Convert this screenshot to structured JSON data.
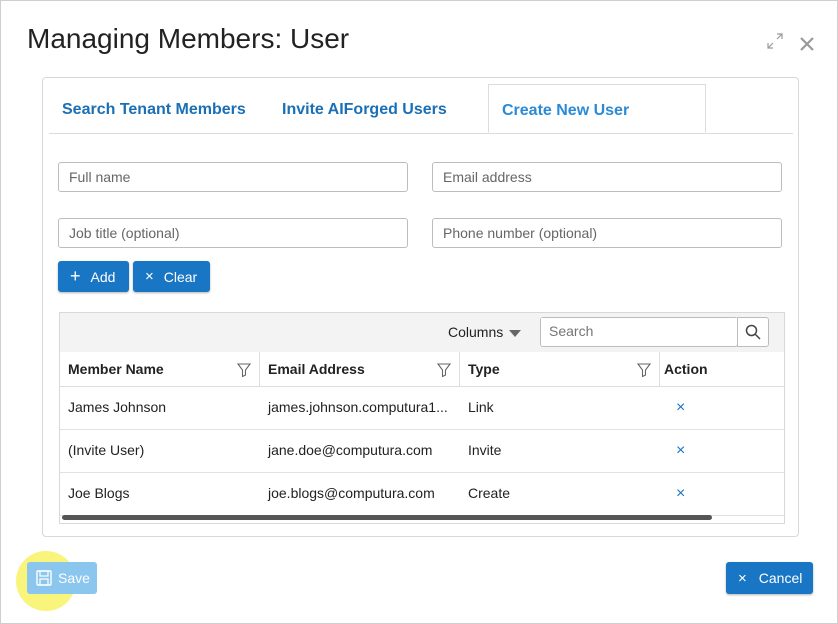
{
  "dialog": {
    "title": "Managing Members: User"
  },
  "tabs": [
    {
      "label": "Search Tenant Members"
    },
    {
      "label": "Invite AIForged Users"
    },
    {
      "label": "Create New User"
    }
  ],
  "form": {
    "full_name_placeholder": "Full name",
    "email_placeholder": "Email address",
    "job_title_placeholder": "Job title (optional)",
    "phone_placeholder": "Phone number (optional)",
    "add_label": "Add",
    "clear_label": "Clear"
  },
  "grid": {
    "columns_label": "Columns",
    "search_placeholder": "Search",
    "headers": [
      "Member Name",
      "Email Address",
      "Type",
      "Action"
    ],
    "rows": [
      {
        "name": "James Johnson",
        "email": "james.johnson.computura1...",
        "type": "Link"
      },
      {
        "name": "(Invite User)",
        "email": "jane.doe@computura.com",
        "type": "Invite"
      },
      {
        "name": "Joe Blogs",
        "email": "joe.blogs@computura.com",
        "type": "Create"
      }
    ]
  },
  "footer": {
    "save_label": "Save",
    "cancel_label": "Cancel"
  },
  "colors": {
    "primary": "#1976c4",
    "tab_text": "#1a6fb5",
    "highlight": "#f5f050"
  }
}
